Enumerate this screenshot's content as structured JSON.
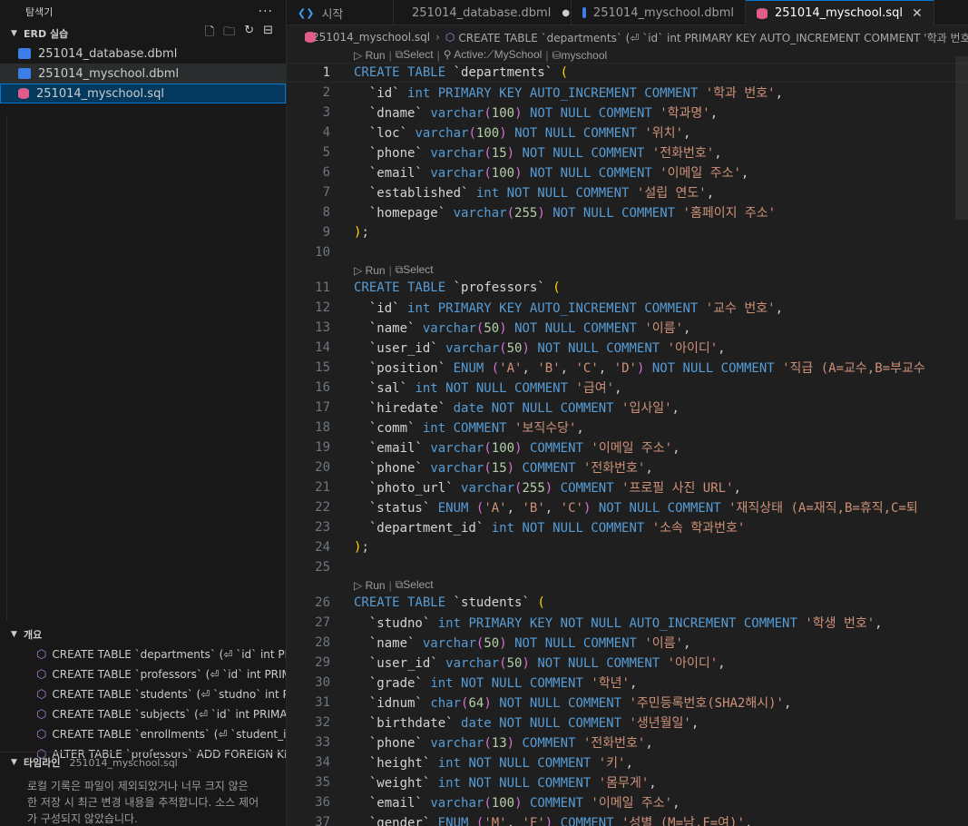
{
  "explorer": {
    "title": "탐색기",
    "more": "···",
    "folder": "ERD 실습",
    "actions": [
      "new-file",
      "new-folder",
      "refresh",
      "collapse"
    ],
    "files": [
      {
        "name": "251014_database.dbml",
        "type": "dbml"
      },
      {
        "name": "251014_myschool.dbml",
        "type": "dbml"
      },
      {
        "name": "251014_myschool.sql",
        "type": "sql"
      }
    ]
  },
  "outline": {
    "title": "개요",
    "items": [
      "CREATE TABLE `departments` (⏎ `id` int PR...",
      "CREATE TABLE `professors` (⏎ `id` int PRIM...",
      "CREATE TABLE `students` (⏎ `studno` int P...",
      "CREATE TABLE `subjects` (⏎ `id` int PRIMA...",
      "CREATE TABLE `enrollments` (⏎ `student_id...",
      "ALTER TABLE `professors` ADD FOREIGN KE..."
    ]
  },
  "timeline": {
    "title": "타임라인",
    "file": "251014_myschool.sql",
    "message": "로컬 기록은 파일이 제외되었거나 너무 크지 않은 한 저장 시 최근 변경 내용을 추적합니다. 소스 제어가 구성되지 않았습니다."
  },
  "tabs": [
    {
      "label": "시작",
      "icon": "vscode-icon"
    },
    {
      "label": "251014_database.dbml",
      "icon": "dbml-icon",
      "dirty": "●"
    },
    {
      "label": "251014_myschool.dbml",
      "icon": "dbml-icon"
    },
    {
      "label": "251014_myschool.sql",
      "icon": "sql-icon",
      "close": "✕"
    }
  ],
  "breadcrumb": {
    "file": "251014_myschool.sql",
    "symbol": "CREATE TABLE `departments` (⏎ `id` int PRIMARY KEY AUTO_INCREMENT COMMENT '학과 번호',"
  },
  "codelens": {
    "first": {
      "run": "Run",
      "select": "Select",
      "active": "Active:",
      "conn": "MySchool",
      "db": "myschool"
    },
    "run": "Run",
    "select": "Select"
  },
  "code_lines": [
    {
      "n": 1,
      "html": "<span class='k'>CREATE TABLE</span> <span class='i'>`departments`</span> <span class='p'>(</span>"
    },
    {
      "n": 2,
      "html": "  <span class='i'>`id`</span> <span class='k'>int PRIMARY KEY AUTO_INCREMENT COMMENT</span> <span class='s'>'학과 번호'</span>,"
    },
    {
      "n": 3,
      "html": "  <span class='i'>`dname`</span> <span class='k'>varchar</span><span class='pp'>(</span><span class='n'>100</span><span class='pp'>)</span> <span class='k'>NOT NULL COMMENT</span> <span class='s'>'학과명'</span>,"
    },
    {
      "n": 4,
      "html": "  <span class='i'>`loc`</span> <span class='k'>varchar</span><span class='pp'>(</span><span class='n'>100</span><span class='pp'>)</span> <span class='k'>NOT NULL COMMENT</span> <span class='s'>'위치'</span>,"
    },
    {
      "n": 5,
      "html": "  <span class='i'>`phone`</span> <span class='k'>varchar</span><span class='pp'>(</span><span class='n'>15</span><span class='pp'>)</span> <span class='k'>NOT NULL COMMENT</span> <span class='s'>'전화번호'</span>,"
    },
    {
      "n": 6,
      "html": "  <span class='i'>`email`</span> <span class='k'>varchar</span><span class='pp'>(</span><span class='n'>100</span><span class='pp'>)</span> <span class='k'>NOT NULL COMMENT</span> <span class='s'>'이메일 주소'</span>,"
    },
    {
      "n": 7,
      "html": "  <span class='i'>`established`</span> <span class='k'>int NOT NULL COMMENT</span> <span class='s'>'설립 연도'</span>,"
    },
    {
      "n": 8,
      "html": "  <span class='i'>`homepage`</span> <span class='k'>varchar</span><span class='pp'>(</span><span class='n'>255</span><span class='pp'>)</span> <span class='k'>NOT NULL COMMENT</span> <span class='s'>'홈페이지 주소'</span>"
    },
    {
      "n": 9,
      "html": "<span class='p'>)</span>;"
    },
    {
      "n": 10,
      "html": ""
    },
    {
      "n": 11,
      "lens": true,
      "html": "<span class='k'>CREATE TABLE</span> <span class='i'>`professors`</span> <span class='p'>(</span>"
    },
    {
      "n": 12,
      "html": "  <span class='i'>`id`</span> <span class='k'>int PRIMARY KEY AUTO_INCREMENT COMMENT</span> <span class='s'>'교수 번호'</span>,"
    },
    {
      "n": 13,
      "html": "  <span class='i'>`name`</span> <span class='k'>varchar</span><span class='pp'>(</span><span class='n'>50</span><span class='pp'>)</span> <span class='k'>NOT NULL COMMENT</span> <span class='s'>'이름'</span>,"
    },
    {
      "n": 14,
      "html": "  <span class='i'>`user_id`</span> <span class='k'>varchar</span><span class='pp'>(</span><span class='n'>50</span><span class='pp'>)</span> <span class='k'>NOT NULL COMMENT</span> <span class='s'>'아이디'</span>,"
    },
    {
      "n": 15,
      "html": "  <span class='i'>`position`</span> <span class='k'>ENUM</span> <span class='pp'>(</span><span class='s'>'A'</span>, <span class='s'>'B'</span>, <span class='s'>'C'</span>, <span class='s'>'D'</span><span class='pp'>)</span> <span class='k'>NOT NULL COMMENT</span> <span class='s'>'직급 (A=교수,B=부교수</span>"
    },
    {
      "n": 16,
      "html": "  <span class='i'>`sal`</span> <span class='k'>int NOT NULL COMMENT</span> <span class='s'>'급여'</span>,"
    },
    {
      "n": 17,
      "html": "  <span class='i'>`hiredate`</span> <span class='k'>date NOT NULL COMMENT</span> <span class='s'>'입사일'</span>,"
    },
    {
      "n": 18,
      "html": "  <span class='i'>`comm`</span> <span class='k'>int COMMENT</span> <span class='s'>'보직수당'</span>,"
    },
    {
      "n": 19,
      "html": "  <span class='i'>`email`</span> <span class='k'>varchar</span><span class='pp'>(</span><span class='n'>100</span><span class='pp'>)</span> <span class='k'>COMMENT</span> <span class='s'>'이메일 주소'</span>,"
    },
    {
      "n": 20,
      "html": "  <span class='i'>`phone`</span> <span class='k'>varchar</span><span class='pp'>(</span><span class='n'>15</span><span class='pp'>)</span> <span class='k'>COMMENT</span> <span class='s'>'전화번호'</span>,"
    },
    {
      "n": 21,
      "html": "  <span class='i'>`photo_url`</span> <span class='k'>varchar</span><span class='pp'>(</span><span class='n'>255</span><span class='pp'>)</span> <span class='k'>COMMENT</span> <span class='s'>'프로필 사진 URL'</span>,"
    },
    {
      "n": 22,
      "html": "  <span class='i'>`status`</span> <span class='k'>ENUM</span> <span class='pp'>(</span><span class='s'>'A'</span>, <span class='s'>'B'</span>, <span class='s'>'C'</span><span class='pp'>)</span> <span class='k'>NOT NULL COMMENT</span> <span class='s'>'재직상태 (A=재직,B=휴직,C=퇴</span>"
    },
    {
      "n": 23,
      "html": "  <span class='i'>`department_id`</span> <span class='k'>int NOT NULL COMMENT</span> <span class='s'>'소속 학과번호'</span>"
    },
    {
      "n": 24,
      "html": "<span class='p'>)</span>;"
    },
    {
      "n": 25,
      "html": ""
    },
    {
      "n": 26,
      "lens": true,
      "html": "<span class='k'>CREATE TABLE</span> <span class='i'>`students`</span> <span class='p'>(</span>"
    },
    {
      "n": 27,
      "html": "  <span class='i'>`studno`</span> <span class='k'>int PRIMARY KEY NOT NULL AUTO_INCREMENT COMMENT</span> <span class='s'>'학생 번호'</span>,"
    },
    {
      "n": 28,
      "html": "  <span class='i'>`name`</span> <span class='k'>varchar</span><span class='pp'>(</span><span class='n'>50</span><span class='pp'>)</span> <span class='k'>NOT NULL COMMENT</span> <span class='s'>'이름'</span>,"
    },
    {
      "n": 29,
      "html": "  <span class='i'>`user_id`</span> <span class='k'>varchar</span><span class='pp'>(</span><span class='n'>50</span><span class='pp'>)</span> <span class='k'>NOT NULL COMMENT</span> <span class='s'>'아이디'</span>,"
    },
    {
      "n": 30,
      "html": "  <span class='i'>`grade`</span> <span class='k'>int NOT NULL COMMENT</span> <span class='s'>'학년'</span>,"
    },
    {
      "n": 31,
      "html": "  <span class='i'>`idnum`</span> <span class='k'>char</span><span class='pp'>(</span><span class='n'>64</span><span class='pp'>)</span> <span class='k'>NOT NULL COMMENT</span> <span class='s'>'주민등록번호(SHA2해시)'</span>,"
    },
    {
      "n": 32,
      "html": "  <span class='i'>`birthdate`</span> <span class='k'>date NOT NULL COMMENT</span> <span class='s'>'생년월일'</span>,"
    },
    {
      "n": 33,
      "html": "  <span class='i'>`phone`</span> <span class='k'>varchar</span><span class='pp'>(</span><span class='n'>13</span><span class='pp'>)</span> <span class='k'>COMMENT</span> <span class='s'>'전화번호'</span>,"
    },
    {
      "n": 34,
      "html": "  <span class='i'>`height`</span> <span class='k'>int NOT NULL COMMENT</span> <span class='s'>'키'</span>,"
    },
    {
      "n": 35,
      "html": "  <span class='i'>`weight`</span> <span class='k'>int NOT NULL COMMENT</span> <span class='s'>'몸무게'</span>,"
    },
    {
      "n": 36,
      "html": "  <span class='i'>`email`</span> <span class='k'>varchar</span><span class='pp'>(</span><span class='n'>100</span><span class='pp'>)</span> <span class='k'>COMMENT</span> <span class='s'>'이메일 주소'</span>,"
    },
    {
      "n": 37,
      "html": "  <span class='i'>`gender`</span> <span class='k'>ENUM</span> <span class='pp'>(</span><span class='s'>'M'</span>, <span class='s'>'F'</span><span class='pp'>)</span> <span class='k'>COMMENT</span> <span class='s'>'성별 (M=남,F=여)'</span>,"
    }
  ],
  "colors": {
    "accent": "#0078d4",
    "keyword": "#569cd6",
    "string": "#ce9178",
    "number": "#b5cea8",
    "bracket": "#ffd700"
  }
}
